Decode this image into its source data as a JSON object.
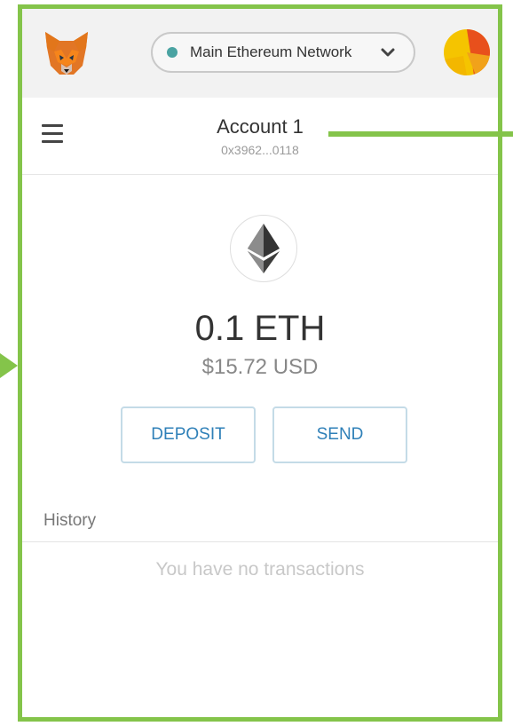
{
  "network": {
    "label": "Main Ethereum Network"
  },
  "account": {
    "name": "Account 1",
    "address": "0x3962...0118"
  },
  "balance": {
    "eth": "0.1 ETH",
    "fiat": "$15.72 USD"
  },
  "actions": {
    "deposit_label": "DEPOSIT",
    "send_label": "SEND"
  },
  "history": {
    "label": "History",
    "empty_text": "You have no transactions"
  },
  "icons": {
    "logo": "metamask-fox-icon",
    "network_status": "network-status-dot",
    "network_dropdown": "chevron-down-icon",
    "account_avatar": "identicon",
    "menu": "hamburger-menu-icon",
    "more": "more-options-icon",
    "token": "ethereum-icon"
  },
  "colors": {
    "annotation": "#84c44a",
    "network_dot": "#4aa3a2",
    "button_text": "#2f80b8",
    "header_bg": "#f2f2f2"
  }
}
